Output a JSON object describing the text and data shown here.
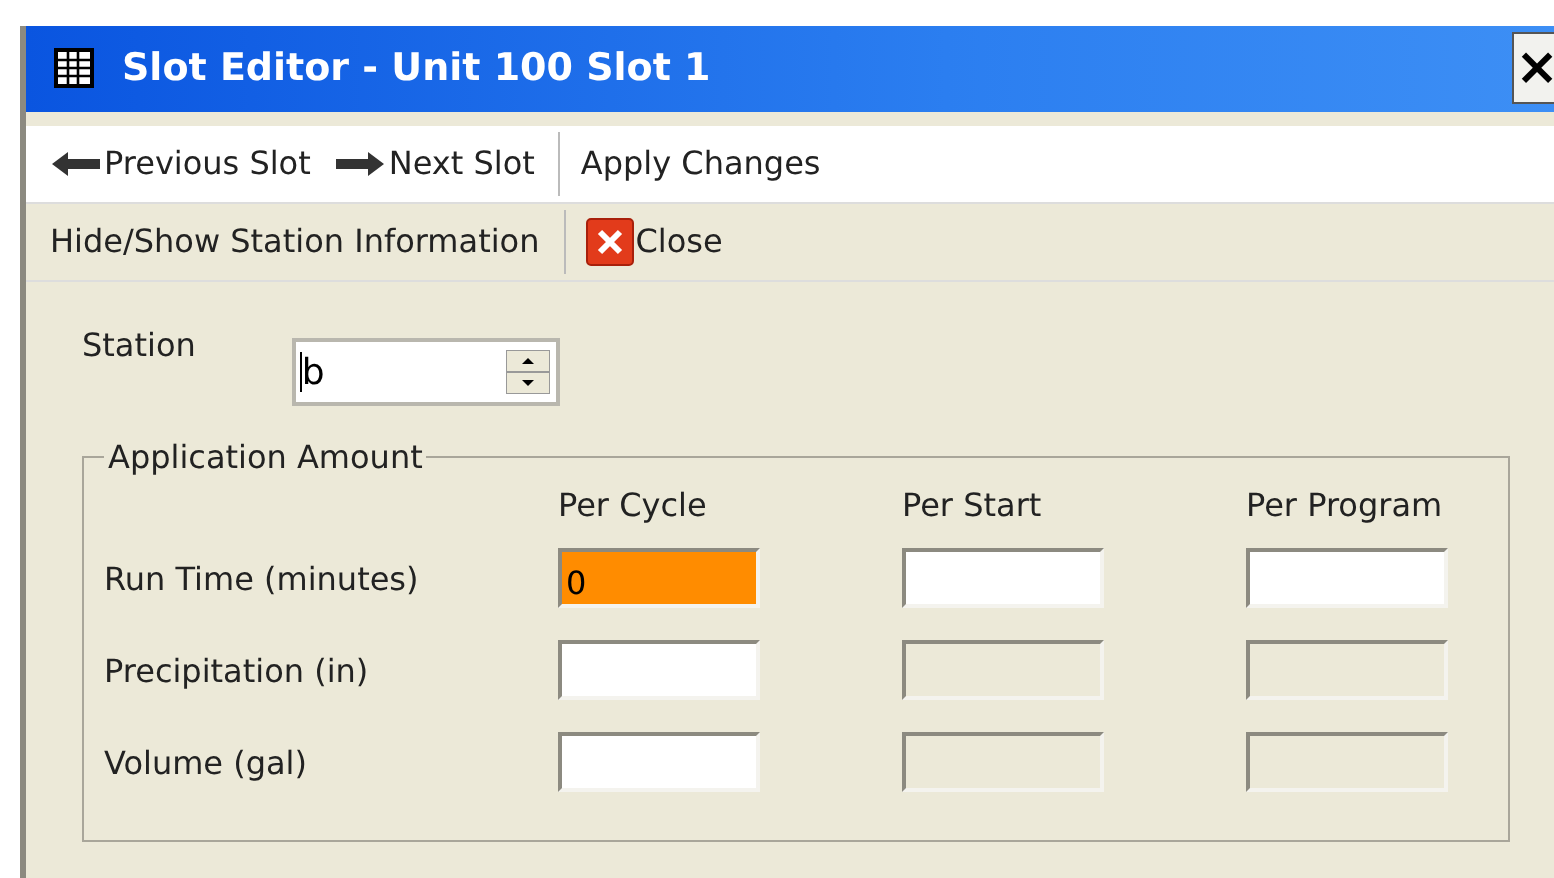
{
  "window": {
    "title": "Slot Editor - Unit 100 Slot 1",
    "close_label": "×"
  },
  "toolbar_rows": [
    {
      "items": [
        {
          "kind": "back",
          "label": "Previous Slot"
        },
        {
          "kind": "forward",
          "label": "Next Slot"
        },
        {
          "kind": "separator"
        },
        {
          "kind": "plain",
          "label": "Apply Changes"
        }
      ]
    },
    {
      "items": [
        {
          "kind": "plain",
          "label": "Hide/Show Station Information"
        },
        {
          "kind": "separator"
        },
        {
          "kind": "close",
          "label": "Close"
        }
      ]
    }
  ],
  "station": {
    "label": "Station",
    "value": "b"
  },
  "application_amount": {
    "title": "Application Amount",
    "columns": [
      "Per Cycle",
      "Per Start",
      "Per Program"
    ],
    "rows": [
      {
        "label": "Run Time (minutes)",
        "cells": [
          {
            "value": "0",
            "highlighted": true,
            "disabled": false
          },
          {
            "highlighted": false,
            "disabled": false
          },
          {
            "highlighted": false,
            "disabled": false
          }
        ]
      },
      {
        "label": "Precipitation (in)",
        "cells": [
          {
            "highlighted": false,
            "disabled": false
          },
          {
            "highlighted": false,
            "disabled": true
          },
          {
            "highlighted": false,
            "disabled": true
          }
        ]
      },
      {
        "label": "Volume (gal)",
        "cells": [
          {
            "highlighted": false,
            "disabled": false
          },
          {
            "highlighted": false,
            "disabled": true
          },
          {
            "highlighted": false,
            "disabled": true
          }
        ]
      }
    ]
  }
}
